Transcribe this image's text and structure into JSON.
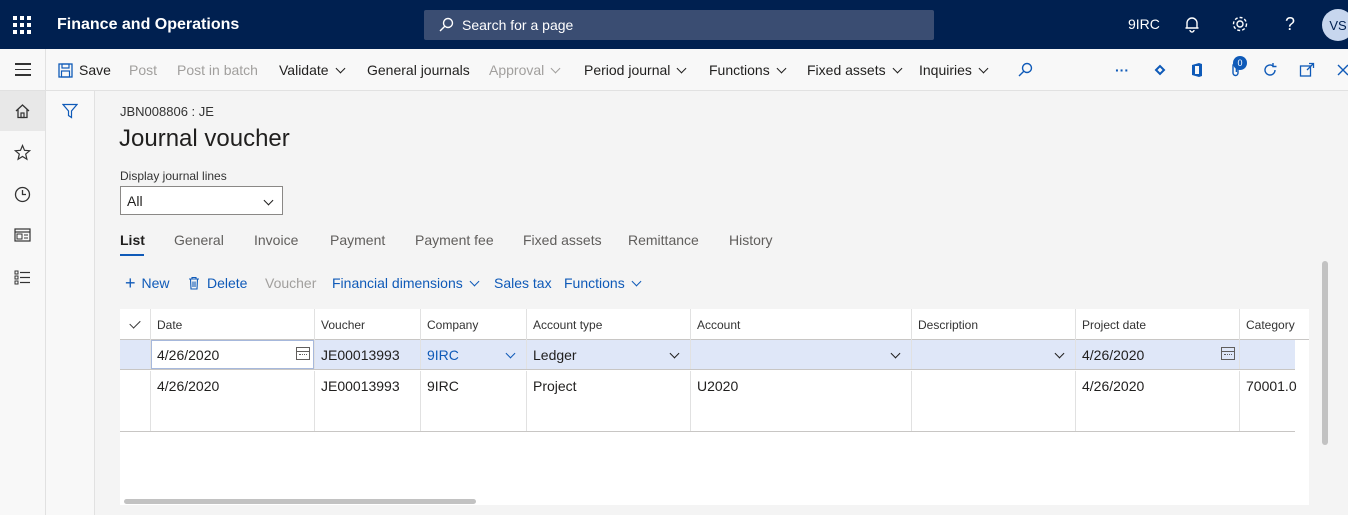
{
  "topbar": {
    "app_title": "Finance and Operations",
    "search_placeholder": "Search for a page",
    "company": "9IRC",
    "avatar_initials": "VS"
  },
  "actions": {
    "save": "Save",
    "post": "Post",
    "post_in_batch": "Post in batch",
    "validate": "Validate",
    "general_journals": "General journals",
    "approval": "Approval",
    "period_journal": "Period journal",
    "functions": "Functions",
    "fixed_assets": "Fixed assets",
    "inquiries": "Inquiries",
    "more": "···",
    "attachments_count": "0"
  },
  "page": {
    "breadcrumb": "JBN008806 : JE",
    "title": "Journal voucher",
    "display_label": "Display journal lines",
    "display_value": "All"
  },
  "tabs": [
    "List",
    "General",
    "Invoice",
    "Payment",
    "Payment fee",
    "Fixed assets",
    "Remittance",
    "History"
  ],
  "grid_actions": {
    "new": "New",
    "delete": "Delete",
    "voucher": "Voucher",
    "financial_dimensions": "Financial dimensions",
    "sales_tax": "Sales tax",
    "functions": "Functions"
  },
  "grid": {
    "columns": [
      "Date",
      "Voucher",
      "Company",
      "Account type",
      "Account",
      "Description",
      "Project date",
      "Category"
    ],
    "rows": [
      [
        "4/26/2020",
        "JE00013993",
        "9IRC",
        "Ledger",
        "",
        "",
        "4/26/2020",
        ""
      ],
      [
        "4/26/2020",
        "JE00013993",
        "9IRC",
        "Project",
        "U2020",
        "",
        "4/26/2020",
        "70001.0"
      ]
    ]
  },
  "colors": {
    "topbar": "#002050",
    "accent": "#0f5ab8",
    "selected_row": "#dfe7f8"
  }
}
